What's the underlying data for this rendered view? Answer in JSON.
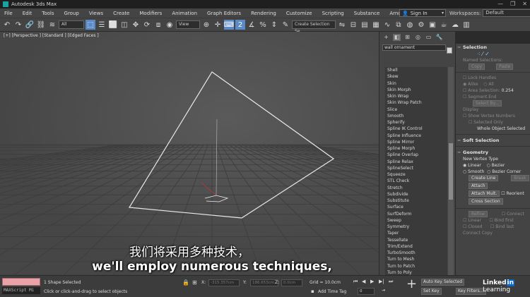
{
  "app": {
    "title": "Autodesk 3ds Max",
    "icon_color": "#1aa3a3"
  },
  "window_controls": [
    "—",
    "❐",
    "✕"
  ],
  "menu": [
    "File",
    "Edit",
    "Tools",
    "Group",
    "Views",
    "Create",
    "Modifiers",
    "Animation",
    "Graph Editors",
    "Rendering",
    "Customize",
    "Scripting",
    "Substance",
    "Arnold",
    "Help"
  ],
  "signin": {
    "label": "Sign In",
    "icon": "user-icon"
  },
  "workspaces": {
    "label": "Workspaces:",
    "value": "Default"
  },
  "toolbar": {
    "selection_filter": "All",
    "reference_coord": "View",
    "named_selection_placeholder": "Create Selection Se",
    "accent_color": "#5b8bc7"
  },
  "viewport": {
    "label": "[+] [Perspective ] [Standard ] [Edged Faces ]",
    "background": "#4b4b4b"
  },
  "command_panel": {
    "object_name": "wall ornament",
    "object_color": "#d8d8d8",
    "modifiers": [
      "Shell",
      "Skew",
      "Skin",
      "Skin Morph",
      "Skin Wrap",
      "Skin Wrap Patch",
      "Slice",
      "Smooth",
      "Spherify",
      "Spline IK Control",
      "Spline Influence",
      "Spline Mirror",
      "Spline Morph",
      "Spline Overlap",
      "Spline Relax",
      "SplineSelect",
      "Squeeze",
      "STL Check",
      "Stretch",
      "Subdivide",
      "Substitute",
      "Surface",
      "SurfDeform",
      "Sweep",
      "Symmetry",
      "Taper",
      "Tessellate",
      "Trim/Extend",
      "TurboSmooth",
      "Turn to Mesh",
      "Turn to Patch",
      "Turn to Poly"
    ]
  },
  "right_panel": {
    "selection_title": "Selection",
    "named_selections": "Named Selections:",
    "copy": "Copy",
    "paste": "Paste",
    "lock_handles": "Lock Handles",
    "alike": "Alike",
    "all": "All",
    "area_selection": "Area Selection:",
    "area_value": "0.254",
    "segment_end": "Segment End",
    "select_by": "Select By...",
    "display": "Display",
    "show_vertex_numbers": "Show Vertex Numbers",
    "selected_only": "Selected Only",
    "whole_object_selected": "Whole Object Selected",
    "soft_selection": "Soft Selection",
    "geometry": "Geometry",
    "new_vertex_type": "New Vertex Type",
    "linear": "Linear",
    "bezier": "Bezier",
    "smooth": "Smooth",
    "bezier_corner": "Bezier Corner",
    "create_line": "Create Line",
    "break": "Break",
    "attach": "Attach",
    "reorient": "Reorient",
    "attach_mult": "Attach Mult.",
    "cross_section": "Cross Section",
    "refine": "Refine",
    "connect": "Connect",
    "linear2": "Linear",
    "bind_first": "Bind first",
    "closed": "Closed",
    "bind_last": "Bind last",
    "connect_copy": "Connect Copy"
  },
  "status": {
    "selected": "1 Shape Selected",
    "prompt": "Click or click-and-drag to select objects",
    "x_label": "X:",
    "x_value": "-315.357cm",
    "y_label": "Y:",
    "y_value": "186.653cm",
    "z_label": "Z:",
    "z_value": "0.0cm",
    "grid": "Grid = 10.0cm",
    "add_time_tag": "Add Time Tag",
    "auto_key": "Auto Key",
    "selected_btn": "Selected",
    "set_key": "Set Key",
    "key_filters": "Key Filters...",
    "frame": "0",
    "maxscript": "MAXScript Mi"
  },
  "subtitles": {
    "chinese": "我们将采用多种技术，",
    "english": "we'll employ numerous techniques,"
  },
  "watermark": {
    "brand": "Linked",
    "in": "in",
    "learning": "Learning"
  }
}
